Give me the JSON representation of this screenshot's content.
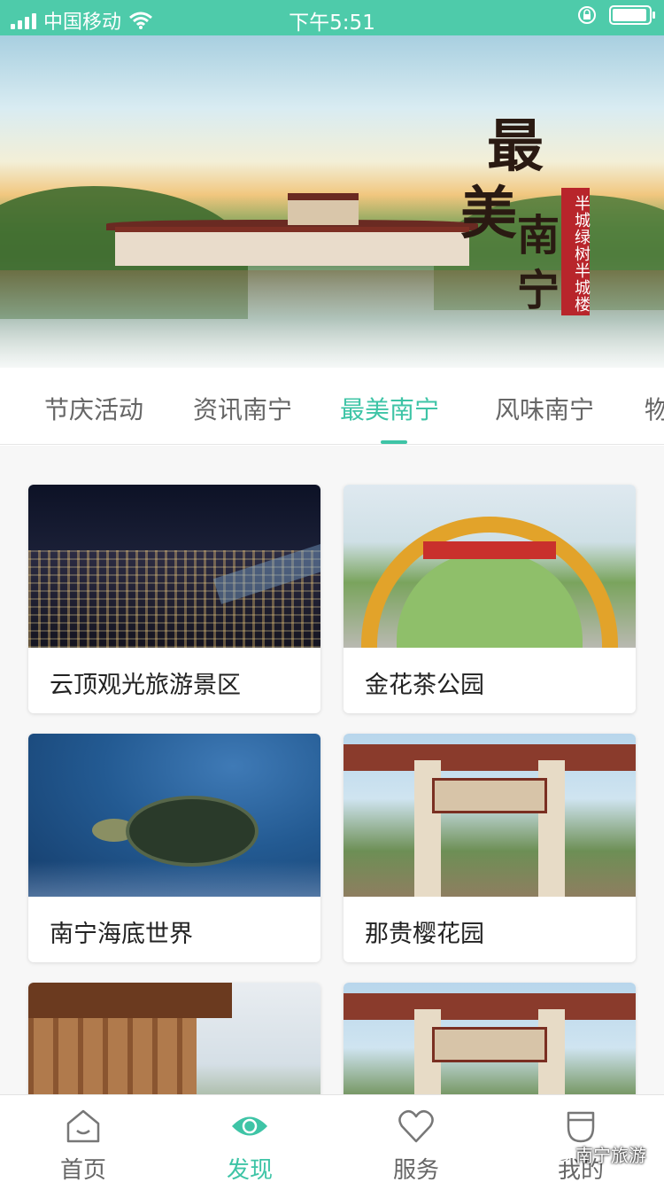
{
  "status_bar": {
    "carrier": "中国移动",
    "time": "下午5:51",
    "battery_level": 0.95
  },
  "banner": {
    "title_chars": [
      "最",
      "美",
      "南",
      "宁"
    ],
    "slogan": "半城绿树半城楼"
  },
  "tabs": {
    "items": [
      {
        "label": "节庆活动"
      },
      {
        "label": "资讯南宁"
      },
      {
        "label": "最美南宁"
      },
      {
        "label": "风味南宁"
      },
      {
        "label": "物"
      }
    ],
    "active_index": 2,
    "accent_color": "#3ec4a6"
  },
  "cards": [
    {
      "title": "云顶观光旅游景区"
    },
    {
      "title": "金花茶公园"
    },
    {
      "title": "南宁海底世界"
    },
    {
      "title": "那贵樱花园"
    },
    {
      "title": ""
    },
    {
      "title": ""
    }
  ],
  "bottom_nav": {
    "items": [
      {
        "label": "首页",
        "icon": "home-icon"
      },
      {
        "label": "发现",
        "icon": "discover-eye-icon"
      },
      {
        "label": "服务",
        "icon": "heart-icon"
      },
      {
        "label": "我的",
        "icon": "profile-icon"
      }
    ],
    "active_index": 1
  },
  "watermark": "南宁旅游",
  "colors": {
    "status_bar": "#4ecbaa",
    "accent": "#3ec4a6",
    "slogan_bg": "#b8252b"
  }
}
